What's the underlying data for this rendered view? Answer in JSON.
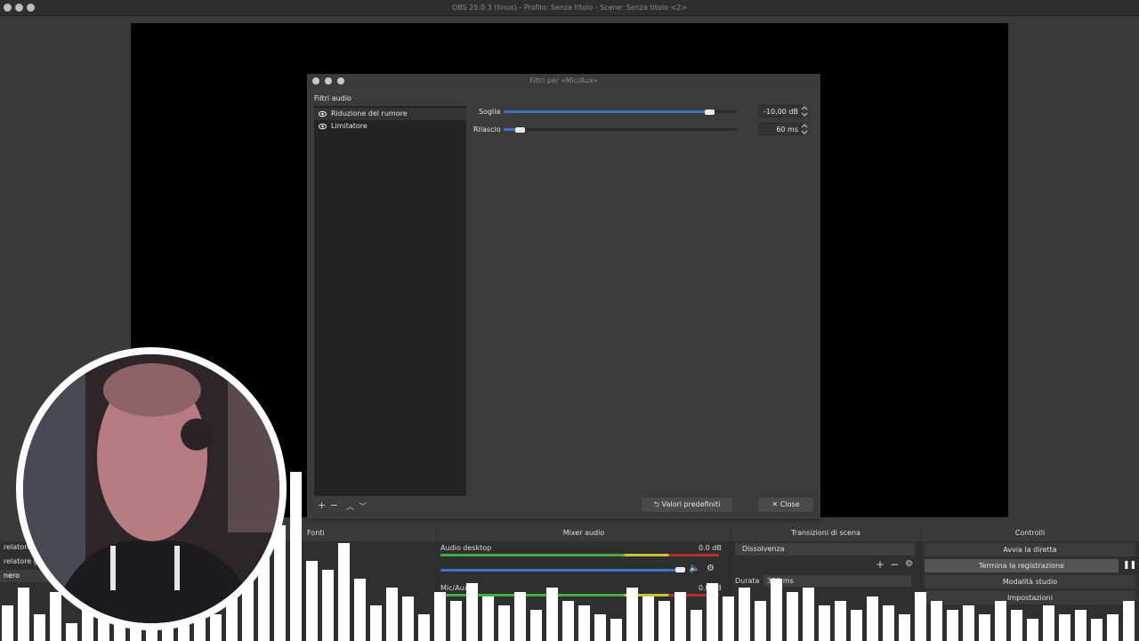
{
  "window": {
    "title": "OBS 25.0.3 (linux) - Profilo: Senza titolo - Scene: Senza titolo <2>"
  },
  "dialog": {
    "title": "Filtri per «Mic/Aux»",
    "section_label": "Filtri audio",
    "filters": [
      {
        "label": "Riduzione del rumore",
        "selected": true
      },
      {
        "label": "Limitatore",
        "selected": false
      }
    ],
    "params": {
      "threshold": {
        "label": "Soglia",
        "value": "-10,00 dB",
        "fraction": 0.88
      },
      "release": {
        "label": "Rilascio",
        "value": "60 ms",
        "fraction": 0.07
      }
    },
    "defaults_button": "Valori predefiniti",
    "close_button": "Close"
  },
  "docks": {
    "sources": {
      "title": "Fonti",
      "scenes": [
        "relatore",
        "relatore g",
        "nero"
      ]
    },
    "mixer": {
      "title": "Mixer audio",
      "channels": [
        {
          "name": "Audio desktop",
          "db": "0.0 dB"
        },
        {
          "name": "Mic/Aux",
          "db": "0.0 dB"
        }
      ]
    },
    "transitions": {
      "title": "Transizioni di scena",
      "selected": "Dissolvenza",
      "duration_label": "Durata",
      "duration_value": "300 ms"
    },
    "controls": {
      "title": "Controlli",
      "buttons": [
        "Avvia la diretta",
        "Termina la registrazione",
        "Modalità studio",
        "Impostazioni"
      ]
    }
  },
  "colors": {
    "accent": "#3d74c6",
    "meter_green": "#3fae3f",
    "meter_yellow": "#c9c23a",
    "meter_red": "#b33030"
  }
}
